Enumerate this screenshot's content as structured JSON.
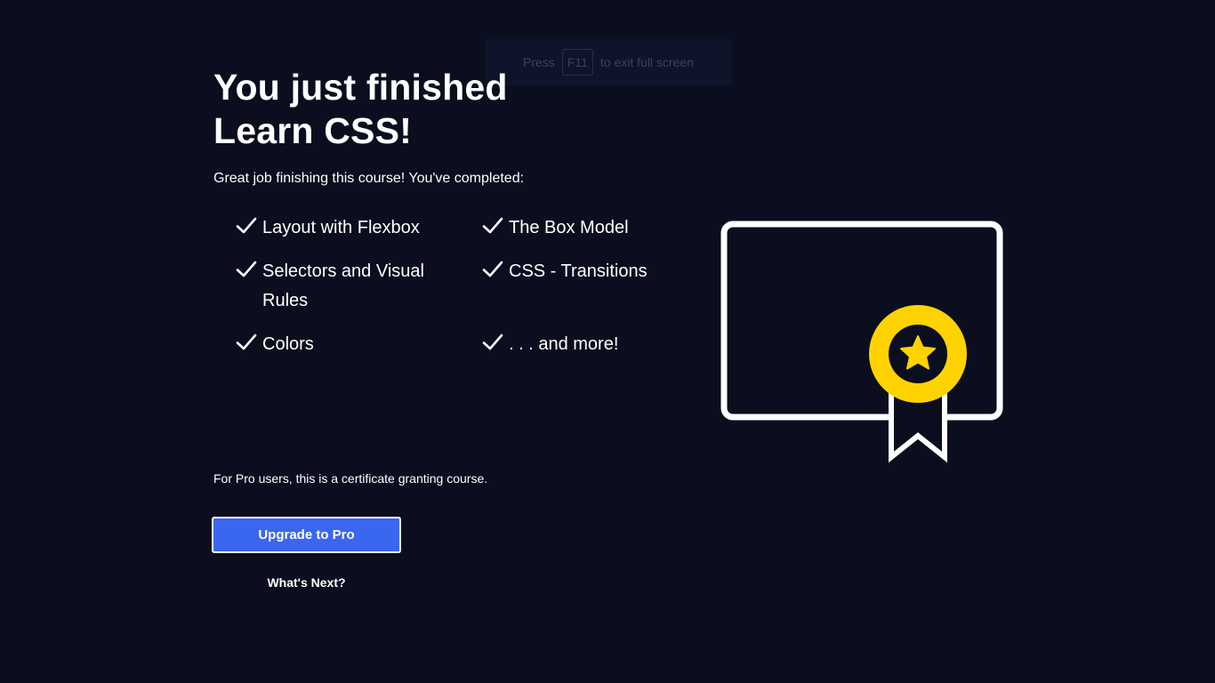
{
  "fullscreen_notice": {
    "press": "Press",
    "key": "F11",
    "rest": "to exit full screen"
  },
  "title": {
    "line1": "You just finished",
    "line2": "Learn CSS!"
  },
  "subtitle": "Great job finishing this course! You've completed:",
  "topics": [
    "Layout with Flexbox",
    "The Box Model",
    "Selectors and Visual Rules",
    "CSS - Transitions",
    "Colors",
    ". . . and more!"
  ],
  "certificate_note": "For Pro users, this is a certificate granting course.",
  "upgrade_button": "Upgrade to Pro",
  "whats_next_link": "What's Next?",
  "colors": {
    "background": "#0b0e1e",
    "accent_button": "#3a66f0",
    "medal": "#ffd300"
  },
  "icons": {
    "check": "checkmark-icon",
    "certificate": "certificate-icon"
  }
}
